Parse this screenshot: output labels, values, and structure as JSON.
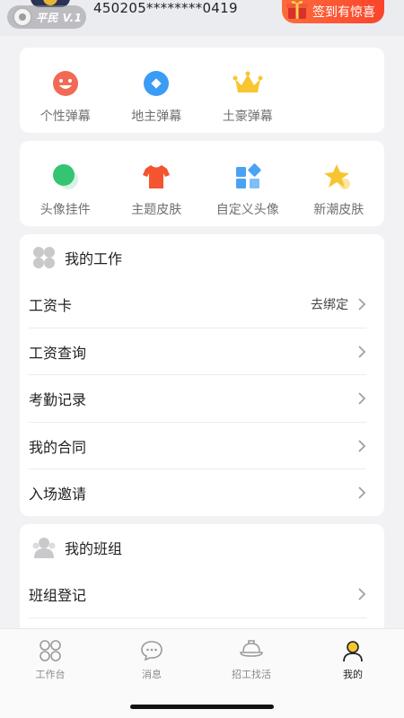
{
  "header": {
    "level_label": "平民 V.1",
    "account_id": "450205********0419",
    "signin_label": "签到有惊喜"
  },
  "barrage": {
    "items": [
      {
        "label": "个性弹幕",
        "icon": "smiley-face-icon",
        "color": "#f26a55"
      },
      {
        "label": "地主弹幕",
        "icon": "blue-diamond-icon",
        "color": "#3a9cf5"
      },
      {
        "label": "土豪弹幕",
        "icon": "crown-icon",
        "color": "#f7c630"
      }
    ]
  },
  "decor": {
    "items": [
      {
        "label": "头像挂件",
        "icon": "green-circle-icon",
        "color": "#34c472"
      },
      {
        "label": "主题皮肤",
        "icon": "tshirt-icon",
        "color": "#f4542f"
      },
      {
        "label": "自定义头像",
        "icon": "blocks-icon",
        "color": "#4aa3f2"
      },
      {
        "label": "新潮皮肤",
        "icon": "star-icon",
        "color": "#f6c531"
      }
    ]
  },
  "work": {
    "title": "我的工作",
    "rows": [
      {
        "label": "工资卡",
        "value": "去绑定"
      },
      {
        "label": "工资查询",
        "value": ""
      },
      {
        "label": "考勤记录",
        "value": ""
      },
      {
        "label": "我的合同",
        "value": ""
      },
      {
        "label": "入场邀请",
        "value": ""
      }
    ]
  },
  "team": {
    "title": "我的班组",
    "rows": [
      {
        "label": "班组登记",
        "value": ""
      }
    ]
  },
  "tabbar": {
    "tabs": [
      {
        "label": "工作台",
        "icon": "workbench-grid-icon"
      },
      {
        "label": "消息",
        "icon": "message-bubble-icon"
      },
      {
        "label": "招工找活",
        "icon": "hardhat-icon"
      },
      {
        "label": "我的",
        "icon": "profile-icon",
        "active": true
      }
    ]
  },
  "colors": {
    "accent": "#f9452b",
    "background": "#f2f2f4"
  }
}
